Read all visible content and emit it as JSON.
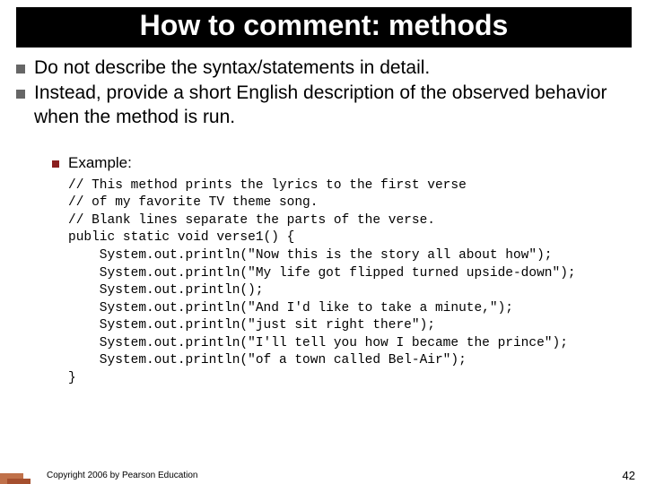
{
  "title": "How to comment: methods",
  "bullets": [
    "Do not describe the syntax/statements in detail.",
    "Instead, provide a short English description of the observed behavior when the method is run."
  ],
  "example_label": "Example:",
  "code": "// This method prints the lyrics to the first verse\n// of my favorite TV theme song.\n// Blank lines separate the parts of the verse.\npublic static void verse1() {\n    System.out.println(\"Now this is the story all about how\");\n    System.out.println(\"My life got flipped turned upside-down\");\n    System.out.println();\n    System.out.println(\"And I'd like to take a minute,\");\n    System.out.println(\"just sit right there\");\n    System.out.println(\"I'll tell you how I became the prince\");\n    System.out.println(\"of a town called Bel-Air\");\n}",
  "copyright": "Copyright 2006 by Pearson Education",
  "page_number": "42"
}
